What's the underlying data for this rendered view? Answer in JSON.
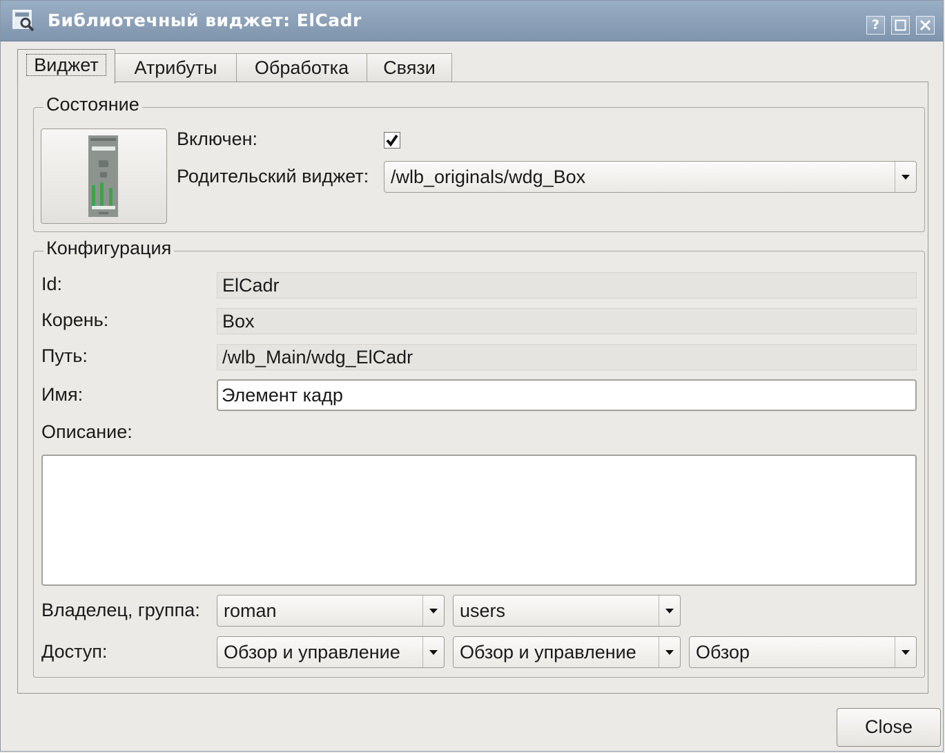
{
  "window": {
    "title": "Библиотечный виджет: ElCadr",
    "help_label": "?"
  },
  "tabs": [
    {
      "label": "Виджет",
      "active": true
    },
    {
      "label": "Атрибуты",
      "active": false
    },
    {
      "label": "Обработка",
      "active": false
    },
    {
      "label": "Связи",
      "active": false
    }
  ],
  "state": {
    "legend": "Состояние",
    "enabled_label": "Включен:",
    "enabled_checked": true,
    "parent_label": "Родительский виджет:",
    "parent_value": "/wlb_originals/wdg_Box"
  },
  "config": {
    "legend": "Конфигурация",
    "id_label": "Id:",
    "id_value": "ElCadr",
    "root_label": "Корень:",
    "root_value": "Box",
    "path_label": "Путь:",
    "path_value": "/wlb_Main/wdg_ElCadr",
    "name_label": "Имя:",
    "name_value": "Элемент кадр",
    "description_label": "Описание:",
    "description_value": "",
    "owner_label": "Владелец, группа:",
    "owner_value": "roman",
    "group_value": "users",
    "access_label": "Доступ:",
    "access_owner": "Обзор и управление",
    "access_group": "Обзор и управление",
    "access_other": "Обзор"
  },
  "buttons": {
    "close_label": "Close"
  },
  "colors": {
    "titlebar": "#8aa0b8",
    "window_bg": "#eceae6",
    "field_readonly_bg": "#e6e4e0"
  },
  "icons": {
    "window": "widget-library-icon",
    "preview": "widget-preview-thumbnail"
  }
}
